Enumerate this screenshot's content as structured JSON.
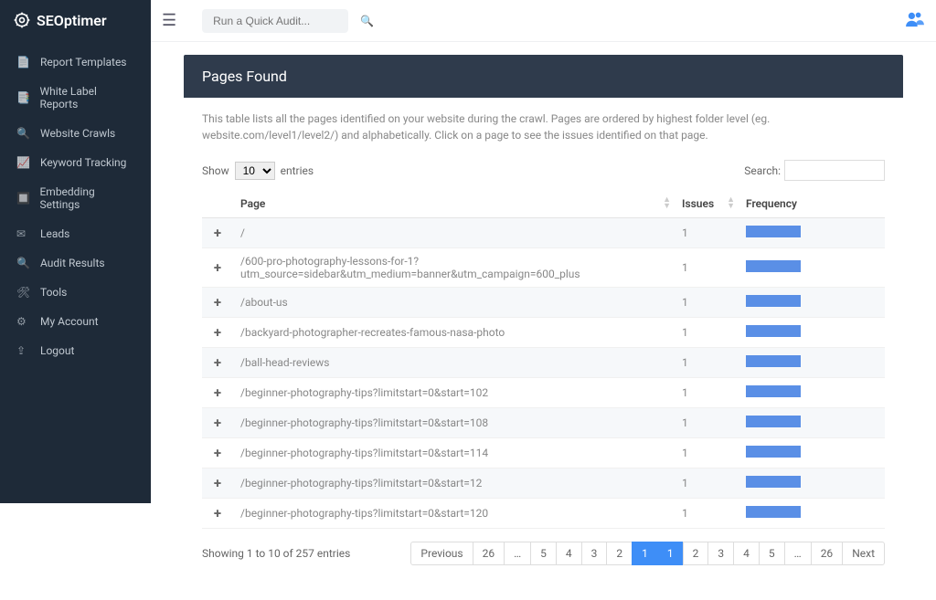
{
  "brand": "SEOptimer",
  "topbar": {
    "quick_audit_placeholder": "Run a Quick Audit..."
  },
  "sidebar": {
    "items": [
      {
        "label": "Report Templates"
      },
      {
        "label": "White Label Reports"
      },
      {
        "label": "Website Crawls"
      },
      {
        "label": "Keyword Tracking"
      },
      {
        "label": "Embedding Settings"
      },
      {
        "label": "Leads"
      },
      {
        "label": "Audit Results"
      },
      {
        "label": "Tools"
      },
      {
        "label": "My Account"
      },
      {
        "label": "Logout"
      }
    ]
  },
  "panel": {
    "title": "Pages Found",
    "description": "This table lists all the pages identified on your website during the crawl. Pages are ordered by highest folder level (eg. website.com/level1/level2/) and alphabetically. Click on a page to see the issues identified on that page.",
    "show_label": "Show",
    "entries_label": "entries",
    "entries_value": "10",
    "search_label": "Search:",
    "columns": {
      "page": "Page",
      "issues": "Issues",
      "frequency": "Frequency"
    },
    "rows": [
      {
        "page": "/",
        "issues": "1"
      },
      {
        "page": "/600-pro-photography-lessons-for-1?utm_source=sidebar&utm_medium=banner&utm_campaign=600_plus",
        "issues": "1"
      },
      {
        "page": "/about-us",
        "issues": "1"
      },
      {
        "page": "/backyard-photographer-recreates-famous-nasa-photo",
        "issues": "1"
      },
      {
        "page": "/ball-head-reviews",
        "issues": "1"
      },
      {
        "page": "/beginner-photography-tips?limitstart=0&start=102",
        "issues": "1"
      },
      {
        "page": "/beginner-photography-tips?limitstart=0&start=108",
        "issues": "1"
      },
      {
        "page": "/beginner-photography-tips?limitstart=0&start=114",
        "issues": "1"
      },
      {
        "page": "/beginner-photography-tips?limitstart=0&start=12",
        "issues": "1"
      },
      {
        "page": "/beginner-photography-tips?limitstart=0&start=120",
        "issues": "1"
      }
    ],
    "footer_info": "Showing 1 to 10 of 257 entries",
    "pager": {
      "prev": "Previous",
      "pages": [
        "1",
        "2",
        "3",
        "4",
        "5",
        "…",
        "26"
      ],
      "next": "Next"
    }
  }
}
